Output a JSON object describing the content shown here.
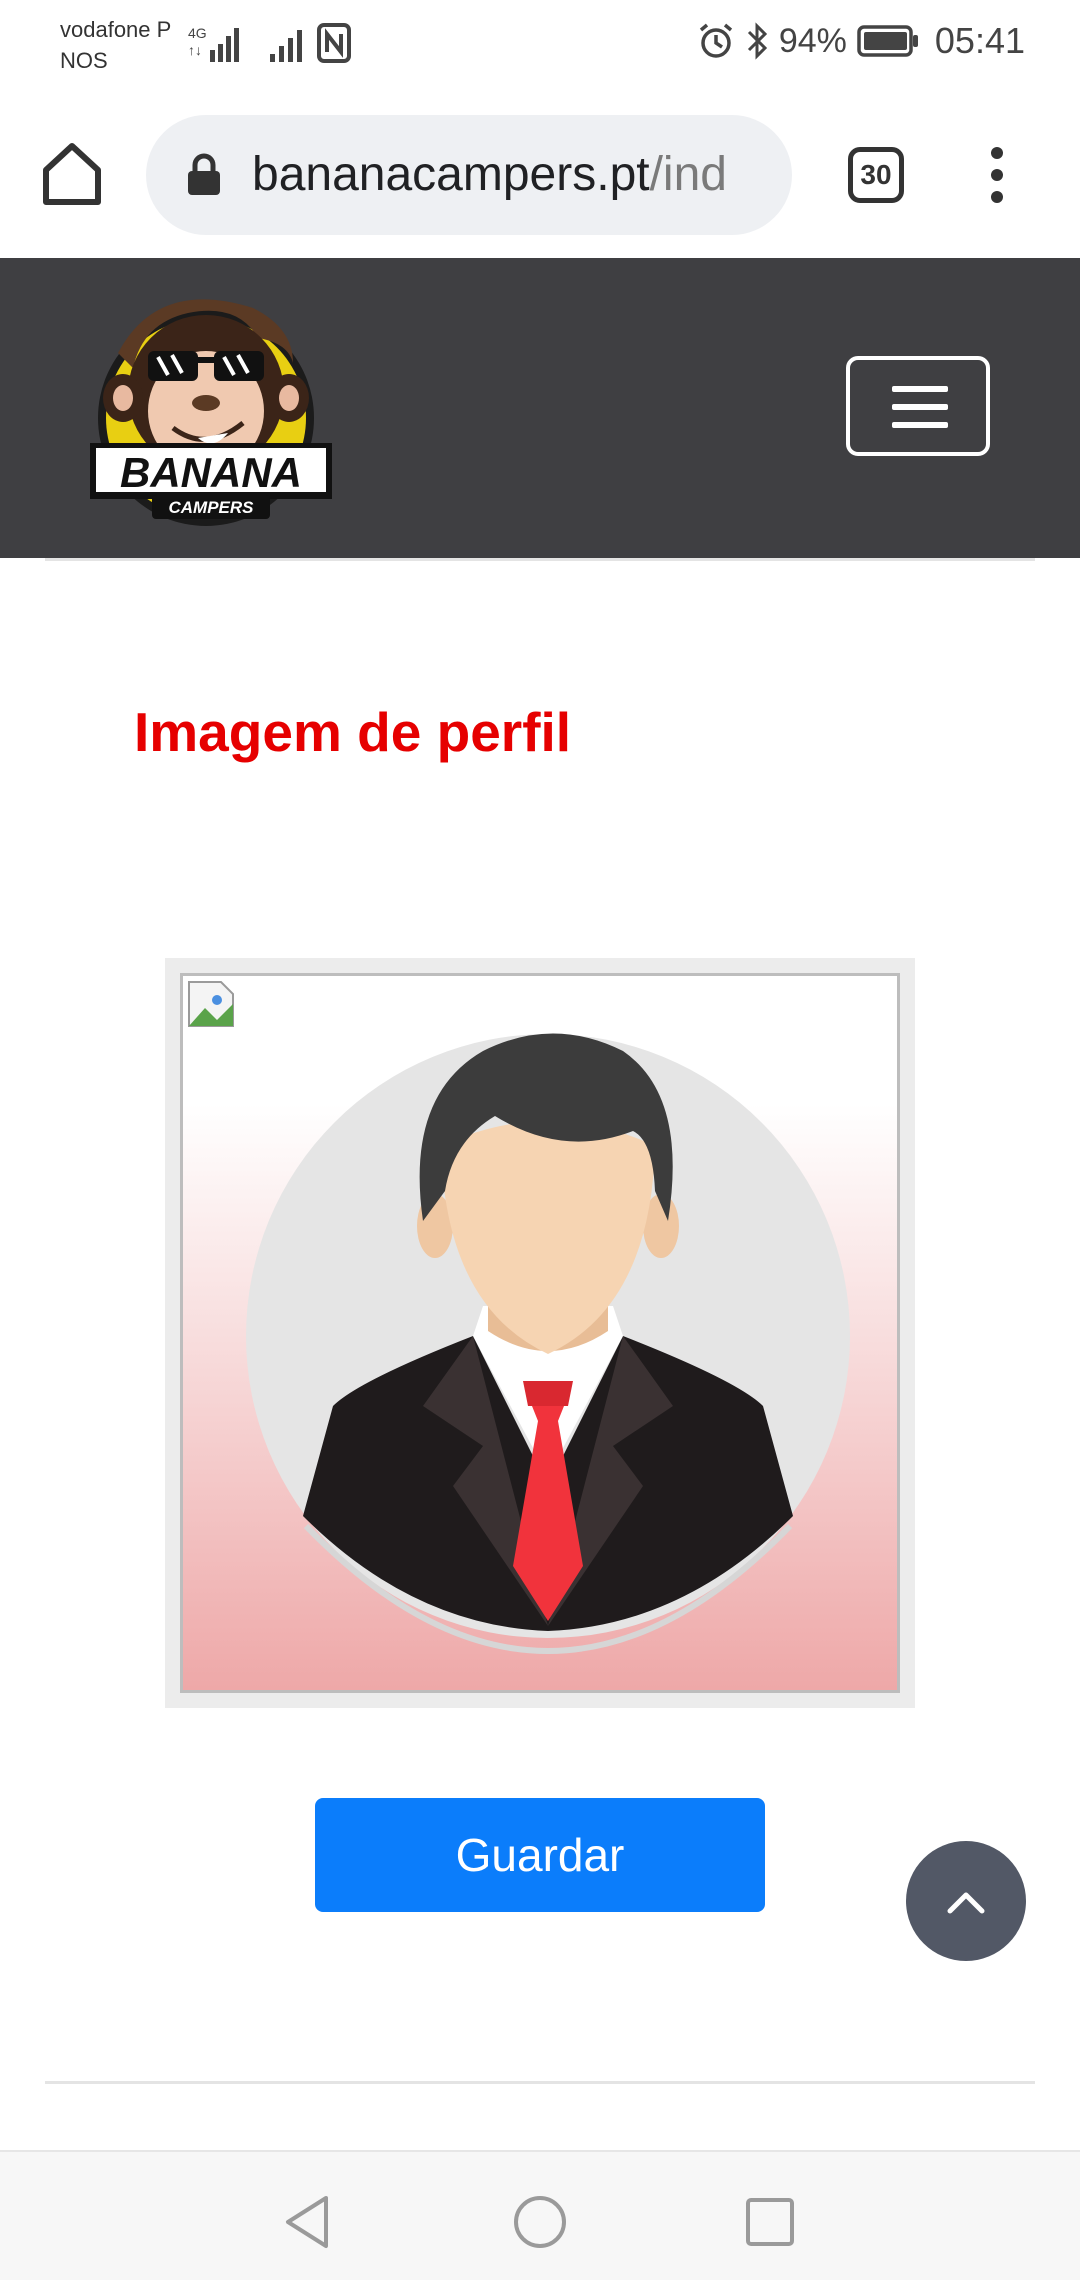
{
  "status_bar": {
    "carrier_line1": "vodafone P",
    "carrier_line2": "NOS",
    "network_type": "4G",
    "battery_percent": "94%",
    "time": "05:41",
    "icons": [
      "signal-icon",
      "nfc-icon",
      "alarm-icon",
      "bluetooth-icon",
      "battery-icon"
    ]
  },
  "browser": {
    "url_host": "bananacampers.pt",
    "url_path": "/ind",
    "tab_count": "30"
  },
  "site": {
    "logo_title": "BANANA",
    "logo_subtitle": "CAMPERS"
  },
  "main": {
    "title": "Imagem de perfil",
    "save_label": "Guardar"
  },
  "colors": {
    "title": "#e60000",
    "primary_button": "#0b7dfb",
    "header_bg": "#3f3f42"
  }
}
